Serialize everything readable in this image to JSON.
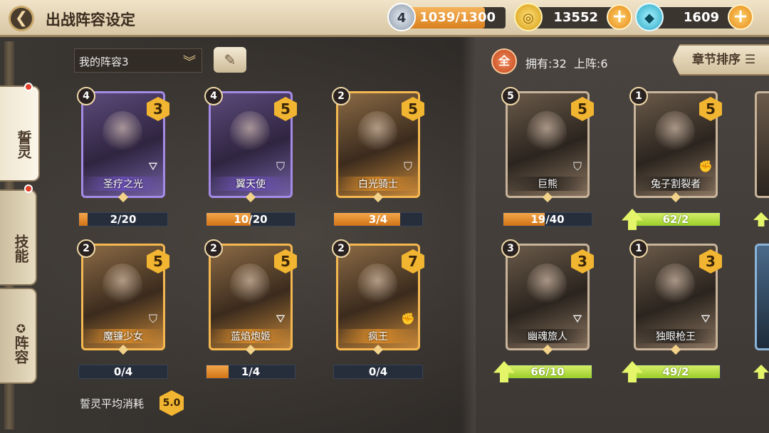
{
  "header": {
    "title": "出战阵容设定",
    "energy": {
      "value": "1039/1300",
      "icon_label": "4",
      "fraction": 0.8
    },
    "gold": {
      "value": "13552"
    },
    "gems": {
      "value": "1609"
    }
  },
  "side_tabs": [
    {
      "label": "誓灵",
      "active": true,
      "red_dot": true
    },
    {
      "label": "技能",
      "active": false,
      "red_dot": true
    },
    {
      "label": "阵容",
      "active": false,
      "red_dot": false,
      "icon": "✪"
    }
  ],
  "lineup": {
    "selected": "我的阵容3"
  },
  "team": [
    {
      "name": "圣疗之光",
      "level": "4",
      "cost": "3",
      "frame": "purple",
      "progress": "2/20",
      "fill": 0.1,
      "class_icon": "bow"
    },
    {
      "name": "翼天使",
      "level": "4",
      "cost": "5",
      "frame": "purple",
      "progress": "10/20",
      "fill": 0.5,
      "class_icon": "shield"
    },
    {
      "name": "白光骑士",
      "level": "2",
      "cost": "5",
      "frame": "orange",
      "progress": "3/4",
      "fill": 0.75,
      "class_icon": "shield"
    },
    {
      "name": "魔镰少女",
      "level": "2",
      "cost": "5",
      "frame": "orange",
      "progress": "0/4",
      "fill": 0,
      "class_icon": "shield"
    },
    {
      "name": "蓝焰炮姬",
      "level": "2",
      "cost": "5",
      "frame": "orange",
      "progress": "1/4",
      "fill": 0.25,
      "class_icon": "bow"
    },
    {
      "name": "疯王",
      "level": "2",
      "cost": "7",
      "frame": "orange",
      "progress": "0/4",
      "fill": 0,
      "class_icon": "fist"
    }
  ],
  "collection_header": {
    "all_label": "全",
    "owned_text": "拥有:32  上阵:6",
    "sort_label": "章节排序"
  },
  "collection": [
    {
      "name": "巨熊",
      "level": "5",
      "cost": "5",
      "frame": "brown",
      "progress": "19/40",
      "fill": 0.47,
      "upgrade": false,
      "class_icon": "shield"
    },
    {
      "name": "兔子割裂者",
      "level": "1",
      "cost": "5",
      "frame": "brown",
      "progress": "62/2",
      "fill": 1,
      "upgrade": true,
      "class_icon": "fist"
    },
    {
      "name": "幽魂旅人",
      "level": "3",
      "cost": "3",
      "frame": "brown",
      "progress": "66/10",
      "fill": 1,
      "upgrade": true,
      "class_icon": "bow"
    },
    {
      "name": "独眼枪王",
      "level": "1",
      "cost": "3",
      "frame": "brown",
      "progress": "49/2",
      "fill": 1,
      "upgrade": true,
      "class_icon": "bow"
    }
  ],
  "footer": {
    "label": "誓灵平均消耗",
    "avg_cost": "5.0"
  }
}
